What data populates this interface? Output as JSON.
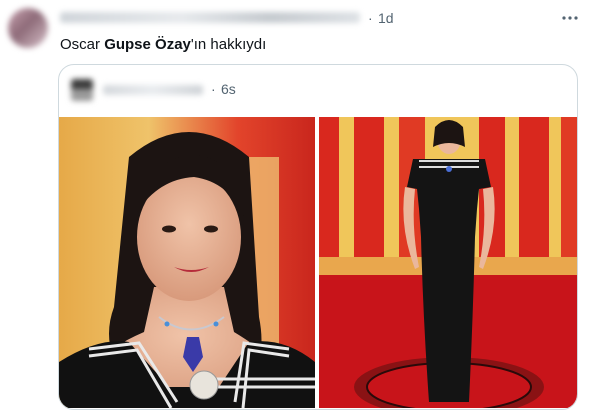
{
  "post": {
    "author_name": "",
    "dot": "·",
    "timestamp": "1d",
    "text_prefix": "Oscar ",
    "text_bold": "Gupse Özay",
    "text_suffix": "'ın hakkıydı",
    "more_icon": "more-horizontal-icon"
  },
  "quote": {
    "author_name": "",
    "dot": "·",
    "timestamp": "6s",
    "images": [
      {
        "alt": "photo-closeup"
      },
      {
        "alt": "photo-full-length"
      }
    ]
  },
  "colors": {
    "text_primary": "#0f1419",
    "text_secondary": "#536471",
    "border": "#cfd9de",
    "backdrop_red": "#d7261e",
    "backdrop_gold": "#e8b84a",
    "carpet_red": "#c8141a"
  }
}
